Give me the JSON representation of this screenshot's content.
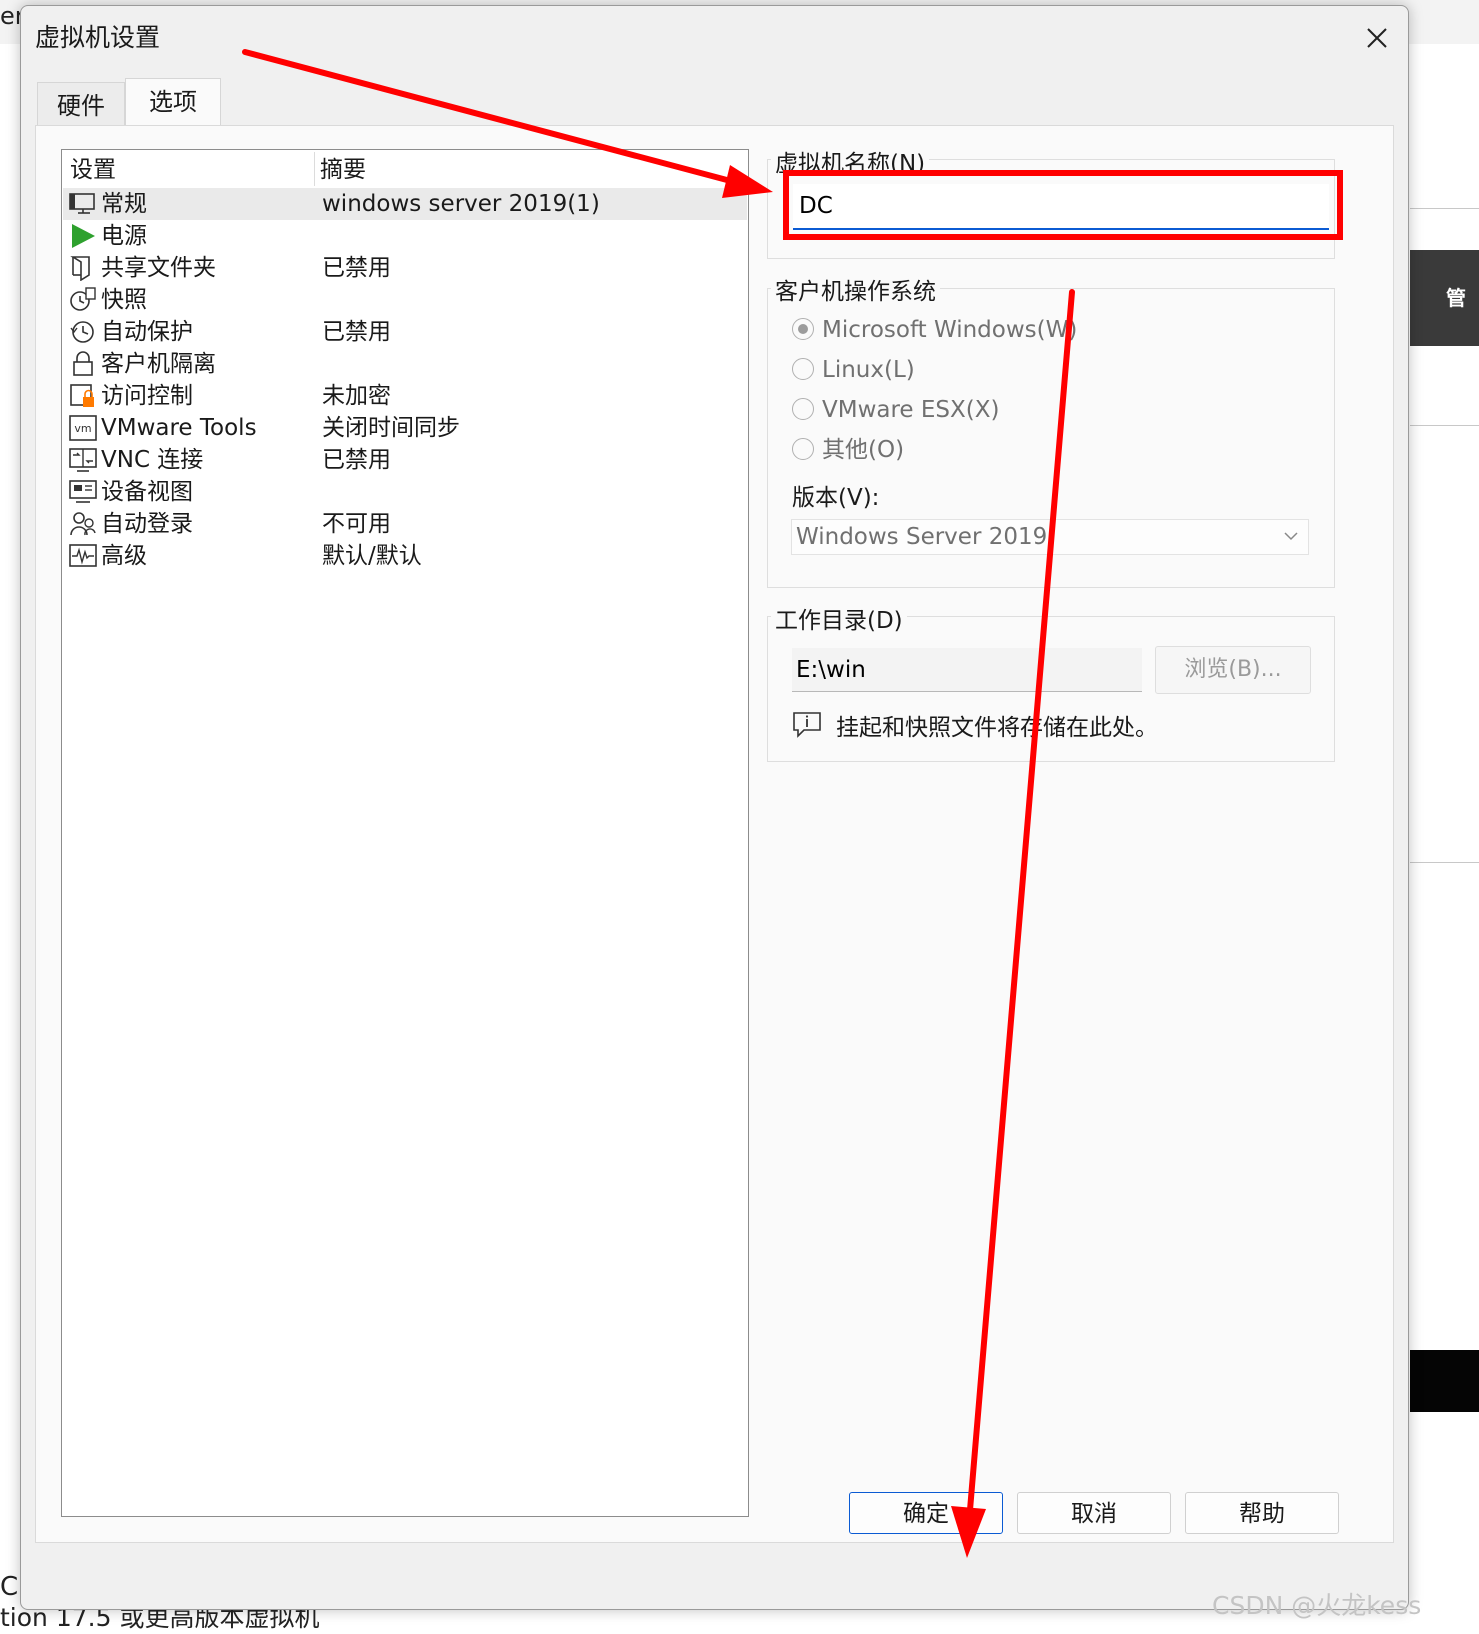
{
  "background": {
    "top_left_fragment": "er",
    "bottom_left_fragment_1": "C.",
    "bottom_left_fragment_2": "tion 17.5 或更高版本虚拟机",
    "right_dark_fragment": "管理"
  },
  "dialog": {
    "title": "虚拟机设置",
    "tabs": [
      {
        "label": "硬件",
        "active": false
      },
      {
        "label": "选项",
        "active": true
      }
    ],
    "settings_list": {
      "headers": {
        "setting": "设置",
        "summary": "摘要"
      },
      "rows": [
        {
          "name": "常规",
          "summary": "windows server 2019(1)",
          "icon": "monitor-icon",
          "selected": true
        },
        {
          "name": "电源",
          "summary": "",
          "icon": "play-icon",
          "selected": false
        },
        {
          "name": "共享文件夹",
          "summary": "已禁用",
          "icon": "shared-folder-icon",
          "selected": false
        },
        {
          "name": "快照",
          "summary": "",
          "icon": "snapshot-icon",
          "selected": false
        },
        {
          "name": "自动保护",
          "summary": "已禁用",
          "icon": "clock-icon",
          "selected": false
        },
        {
          "name": "客户机隔离",
          "summary": "",
          "icon": "lock-icon",
          "selected": false
        },
        {
          "name": "访问控制",
          "summary": "未加密",
          "icon": "access-control-icon",
          "selected": false
        },
        {
          "name": "VMware Tools",
          "summary": "关闭时间同步",
          "icon": "vm-icon",
          "selected": false
        },
        {
          "name": "VNC 连接",
          "summary": "已禁用",
          "icon": "vnc-icon",
          "selected": false
        },
        {
          "name": "设备视图",
          "summary": "",
          "icon": "device-view-icon",
          "selected": false
        },
        {
          "name": "自动登录",
          "summary": "不可用",
          "icon": "users-icon",
          "selected": false
        },
        {
          "name": "高级",
          "summary": "默认/默认",
          "icon": "waveform-icon",
          "selected": false
        }
      ]
    },
    "vm_name": {
      "label": "虚拟机名称(N)",
      "value": "DC"
    },
    "guest_os": {
      "label": "客户机操作系统",
      "options": [
        {
          "label": "Microsoft Windows(W)",
          "checked": true
        },
        {
          "label": "Linux(L)",
          "checked": false
        },
        {
          "label": "VMware ESX(X)",
          "checked": false
        },
        {
          "label": "其他(O)",
          "checked": false
        }
      ],
      "version_label": "版本(V):",
      "version_value": "Windows Server 2019"
    },
    "working_dir": {
      "label": "工作目录(D)",
      "value": "E:\\win",
      "browse_label": "浏览(B)...",
      "info_text": "挂起和快照文件将存储在此处。"
    },
    "buttons": {
      "ok": "确定",
      "cancel": "取消",
      "help": "帮助"
    }
  },
  "watermark": "CSDN @火龙kess",
  "colors": {
    "annotation_red": "#ff0000",
    "focus_blue": "#0b5bd3",
    "power_green": "#2ea12e"
  }
}
